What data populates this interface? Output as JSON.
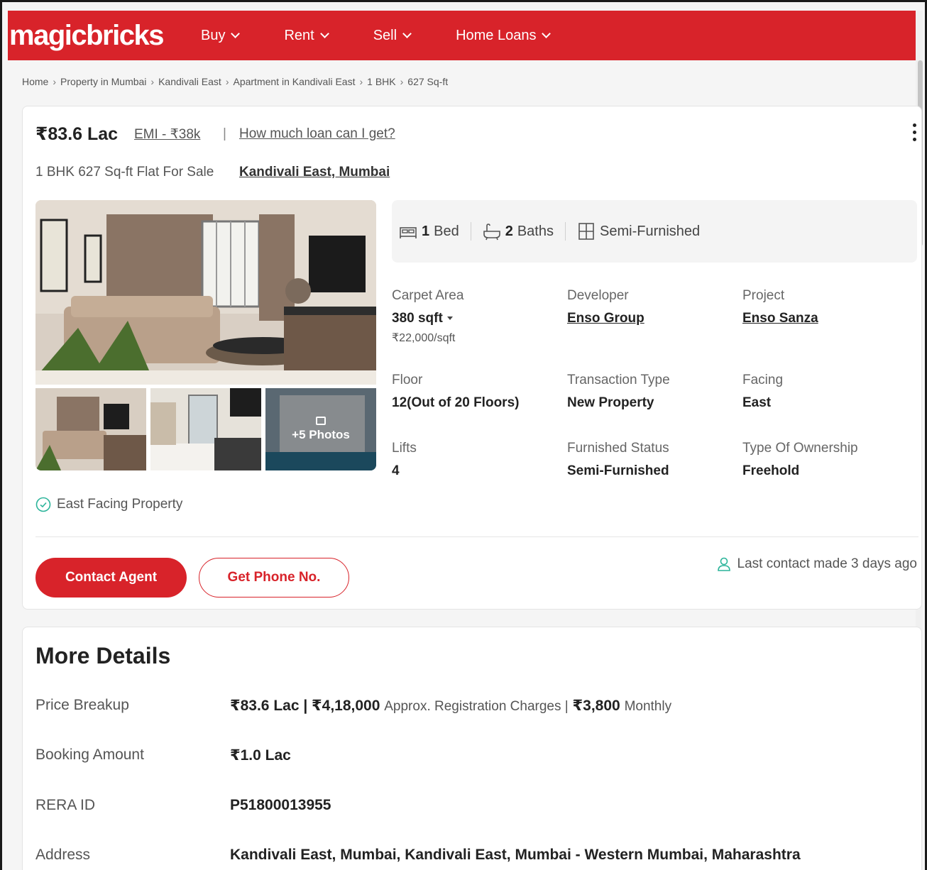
{
  "nav": {
    "logo": "magicbricks",
    "items": [
      {
        "label": "Buy"
      },
      {
        "label": "Rent"
      },
      {
        "label": "Sell"
      },
      {
        "label": "Home Loans"
      }
    ],
    "brand_color": "#d8232a"
  },
  "breadcrumb": [
    "Home",
    "Property in Mumbai",
    "Kandivali East",
    "Apartment in Kandivali East",
    "1 BHK",
    "627 Sq-ft"
  ],
  "listing": {
    "price": "₹83.6 Lac",
    "emi": "EMI - ₹38k",
    "loan_link": "How much loan can I get?",
    "subtitle": "1 BHK 627 Sq-ft Flat For Sale",
    "locality": "Kandivali East, Mumbai",
    "photo_overlay": "+5 Photos",
    "amenities": {
      "bed_count": "1",
      "bed_label": "Bed",
      "bath_count": "2",
      "bath_label": "Baths",
      "furnishing": "Semi-Furnished"
    },
    "summary": {
      "carpet_label": "Carpet Area",
      "carpet_value": "380 sqft",
      "carpet_rate": "₹22,000/sqft",
      "developer_label": "Developer",
      "developer_value": "Enso Group",
      "project_label": "Project",
      "project_value": "Enso Sanza",
      "floor_label": "Floor",
      "floor_value": "12(Out of 20 Floors)",
      "transaction_label": "Transaction Type",
      "transaction_value": "New Property",
      "facing_label": "Facing",
      "facing_value": "East",
      "lifts_label": "Lifts",
      "lifts_value": "4",
      "furnished_label": "Furnished Status",
      "furnished_value": "Semi-Furnished",
      "ownership_label": "Type Of Ownership",
      "ownership_value": "Freehold"
    },
    "facing_tag": "East Facing Property",
    "contact_button": "Contact Agent",
    "phone_button": "Get Phone No.",
    "last_contact": "Last contact made 3 days ago"
  },
  "more_details": {
    "title": "More Details",
    "price_breakup_label": "Price Breakup",
    "price_breakup_price": "₹83.6 Lac | ₹4,18,000",
    "price_breakup_reg": "Approx. Registration Charges |",
    "price_breakup_maint": "₹3,800",
    "price_breakup_monthly": "Monthly",
    "booking_label": "Booking Amount",
    "booking_value": "₹1.0 Lac",
    "rera_label": "RERA ID",
    "rera_value": "P51800013955",
    "address_label": "Address",
    "address_value": "Kandivali East, Mumbai, Kandivali East, Mumbai - Western Mumbai, Maharashtra"
  }
}
